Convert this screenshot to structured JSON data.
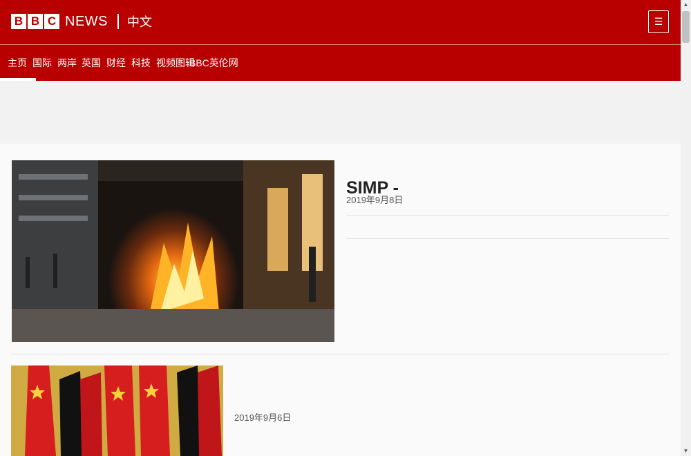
{
  "header": {
    "logo_letters": [
      "B",
      "B",
      "C"
    ],
    "logo_news": "NEWS",
    "logo_lang": "中文",
    "menu_icon": "menu-icon"
  },
  "nav": {
    "items": [
      {
        "label": "主页",
        "active": true
      },
      {
        "label": "国际"
      },
      {
        "label": "两岸"
      },
      {
        "label": "英国"
      },
      {
        "label": "财经"
      },
      {
        "label": "科技"
      },
      {
        "label": "视频图辑"
      },
      {
        "label": "BBC英伦网"
      }
    ]
  },
  "hero": {
    "image": "hong-kong-protest-fire-photo",
    "title": "SIMP - ",
    "date": "2019年9月8日",
    "links": [
      "",
      " "
    ]
  },
  "story": {
    "image": "china-germany-flags-photo",
    "title": " ",
    "summary": "",
    "date": "2019年9月6日"
  },
  "colors": {
    "brand_red": "#b80000",
    "background": "#fafafa",
    "ad_band": "#f2f2f2"
  }
}
